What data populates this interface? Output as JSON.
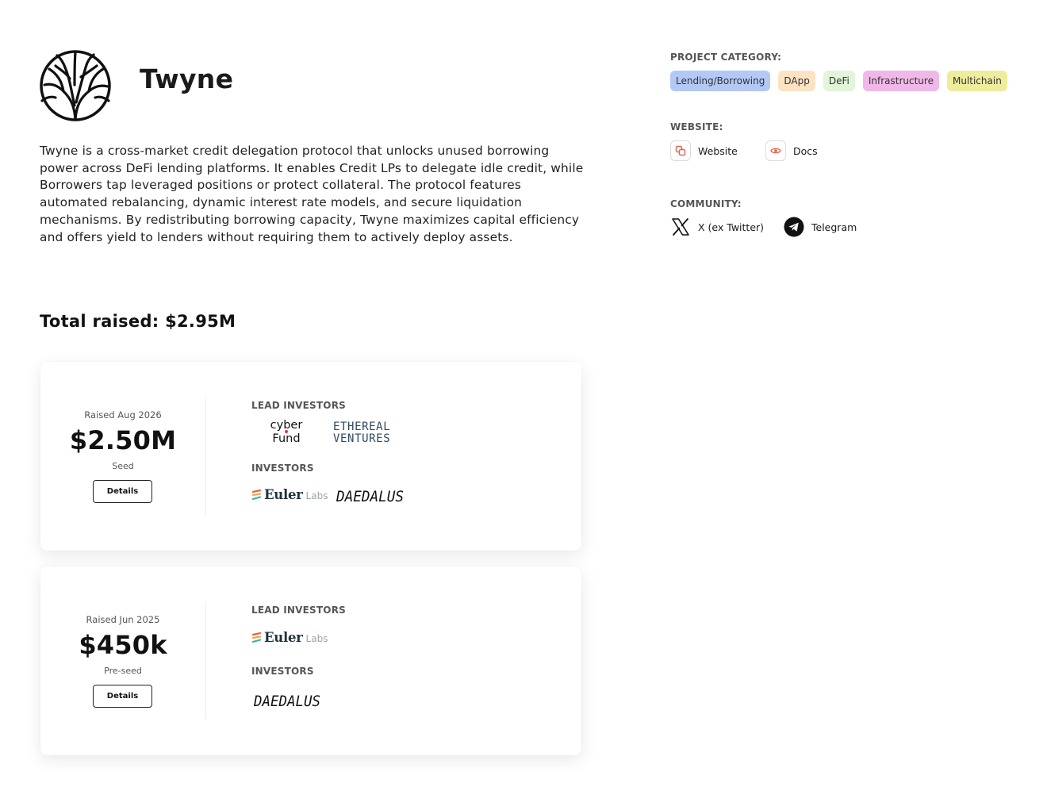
{
  "project": {
    "name": "Twyne",
    "description": "Twyne is a cross-market credit delegation protocol that unlocks unused borrowing power across DeFi lending platforms. It enables Credit LPs to delegate idle credit, while Borrowers tap leveraged positions or protect collateral. The protocol features automated rebalancing, dynamic interest rate models, and secure liquidation mechanisms. By redistributing borrowing capacity, Twyne maximizes capital efficiency and offers yield to lenders without requiring them to actively deploy assets.",
    "logo_icon": "twyne-tree-logo"
  },
  "total_raised": "Total raised: $2.95M",
  "rounds": [
    {
      "date": "Raised Aug 2026",
      "amount": "$2.50M",
      "stage": "Seed",
      "details_label": "Details",
      "lead_label": "LEAD INVESTORS",
      "investors_label": "INVESTORS",
      "lead_investors": [
        {
          "name": "cyber Fund",
          "line1": "cyber",
          "line2": "Fund"
        },
        {
          "name": "Ethereal Ventures",
          "line1": "ETHEREAL",
          "line2": "VENTURES"
        }
      ],
      "investors": [
        {
          "name": "Euler Labs",
          "word": "Euler",
          "suffix": "Labs"
        },
        {
          "name": "Daedalus",
          "word": "DAEDALUS"
        }
      ]
    },
    {
      "date": "Raised Jun 2025",
      "amount": "$450k",
      "stage": "Pre-seed",
      "details_label": "Details",
      "lead_label": "LEAD INVESTORS",
      "investors_label": "INVESTORS",
      "lead_investors": [
        {
          "name": "Euler Labs",
          "word": "Euler",
          "suffix": "Labs"
        }
      ],
      "investors": [
        {
          "name": "Daedalus",
          "word": "DAEDALUS"
        }
      ]
    }
  ],
  "sidebar": {
    "category_label": "PROJECT CATEGORY:",
    "categories": [
      {
        "label": "Lending/Borrowing",
        "color": "#b3c8f5"
      },
      {
        "label": "DApp",
        "color": "#fde3c3"
      },
      {
        "label": "DeFi",
        "color": "#e3f5d9"
      },
      {
        "label": "Infrastructure",
        "color": "#f0b8e8"
      },
      {
        "label": "Multichain",
        "color": "#eeed9c"
      }
    ],
    "website_label": "WEBSITE:",
    "website_links": [
      {
        "label": "Website",
        "icon": "link-icon"
      },
      {
        "label": "Docs",
        "icon": "eye-icon"
      }
    ],
    "community_label": "COMMUNITY:",
    "community_links": [
      {
        "label": "X (ex Twitter)",
        "icon": "x-twitter-icon"
      },
      {
        "label": "Telegram",
        "icon": "telegram-icon"
      }
    ]
  },
  "colors": {
    "accent_red": "#e8604c",
    "text_dark": "#1a1a1a",
    "label_gray": "#555555"
  }
}
